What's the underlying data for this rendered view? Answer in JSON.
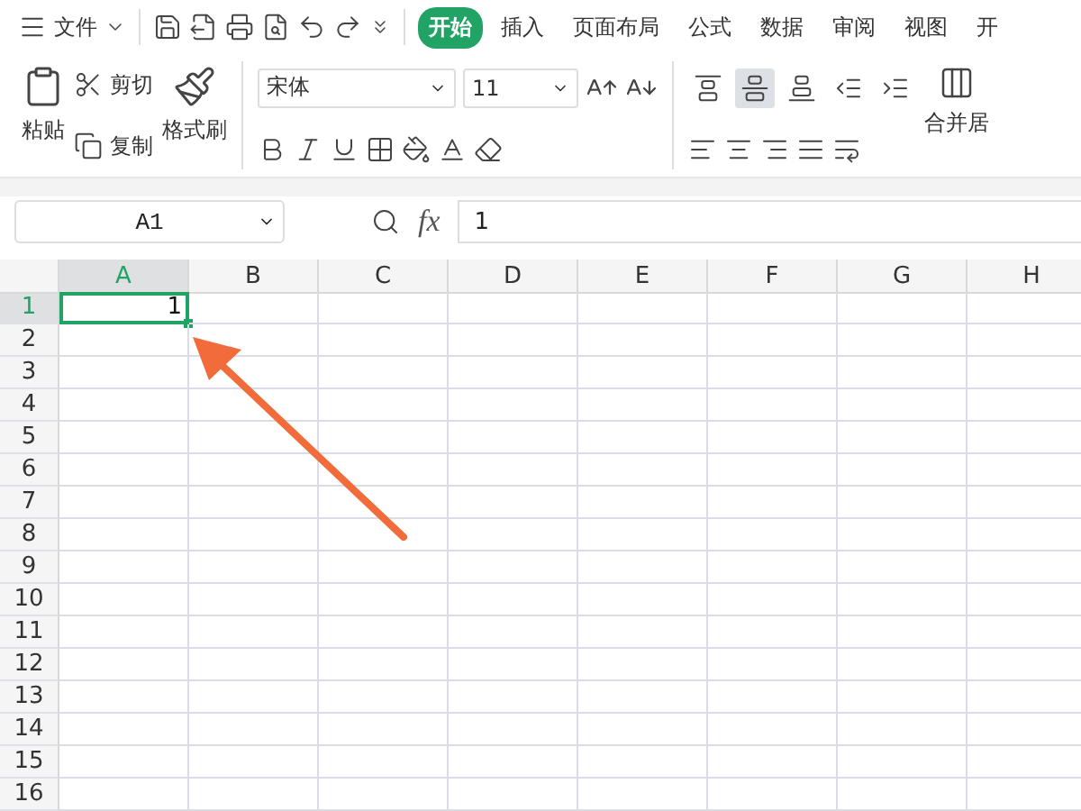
{
  "menu": {
    "file": "文件",
    "tabs": [
      {
        "label": "开始",
        "selected": true
      },
      {
        "label": "插入",
        "selected": false
      },
      {
        "label": "页面布局",
        "selected": false
      },
      {
        "label": "公式",
        "selected": false
      },
      {
        "label": "数据",
        "selected": false
      },
      {
        "label": "审阅",
        "selected": false
      },
      {
        "label": "视图",
        "selected": false
      },
      {
        "label": "开",
        "selected": false
      }
    ]
  },
  "ribbon": {
    "paste": "粘贴",
    "cut": "剪切",
    "copy": "复制",
    "format_painter": "格式刷",
    "font": "宋体",
    "size": "11",
    "merge": "合并居",
    "align_top": [
      {
        "kind": "top",
        "selected": false
      },
      {
        "kind": "middle",
        "selected": true
      },
      {
        "kind": "bottom",
        "selected": false
      },
      {
        "kind": "outdent",
        "selected": false
      },
      {
        "kind": "indent",
        "selected": false
      }
    ]
  },
  "formula_bar": {
    "name_box": "A1",
    "fx": "fx",
    "value": "1"
  },
  "sheet": {
    "columns": [
      {
        "label": "A",
        "selected": true
      },
      {
        "label": "B",
        "selected": false
      },
      {
        "label": "C",
        "selected": false
      },
      {
        "label": "D",
        "selected": false
      },
      {
        "label": "E",
        "selected": false
      },
      {
        "label": "F",
        "selected": false
      },
      {
        "label": "G",
        "selected": false
      },
      {
        "label": "H",
        "selected": false
      }
    ],
    "rows": [
      {
        "label": "1",
        "selected": true,
        "cells": [
          "1"
        ]
      },
      {
        "label": "2",
        "selected": false,
        "cells": []
      },
      {
        "label": "3",
        "selected": false,
        "cells": []
      },
      {
        "label": "4",
        "selected": false,
        "cells": []
      },
      {
        "label": "5",
        "selected": false,
        "cells": []
      },
      {
        "label": "6",
        "selected": false,
        "cells": []
      },
      {
        "label": "7",
        "selected": false,
        "cells": []
      },
      {
        "label": "8",
        "selected": false,
        "cells": []
      },
      {
        "label": "9",
        "selected": false,
        "cells": []
      },
      {
        "label": "10",
        "selected": false,
        "cells": []
      },
      {
        "label": "11",
        "selected": false,
        "cells": []
      },
      {
        "label": "12",
        "selected": false,
        "cells": []
      },
      {
        "label": "13",
        "selected": false,
        "cells": []
      },
      {
        "label": "14",
        "selected": false,
        "cells": []
      },
      {
        "label": "15",
        "selected": false,
        "cells": []
      },
      {
        "label": "16",
        "selected": false,
        "cells": []
      }
    ]
  }
}
